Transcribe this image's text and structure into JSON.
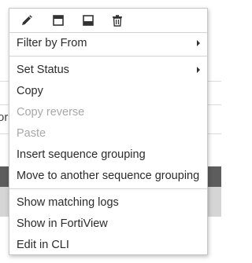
{
  "background": {
    "fragment_text": "or"
  },
  "toolbar": {
    "icons": [
      "pencil-icon",
      "dock-top-icon",
      "dock-bottom-icon",
      "trash-icon"
    ]
  },
  "menu": {
    "filter_by_from": "Filter by From",
    "set_status": "Set Status",
    "copy": "Copy",
    "copy_reverse": "Copy reverse",
    "paste": "Paste",
    "insert_sequence_grouping": "Insert sequence grouping",
    "move_to_sequence_grouping": "Move to another sequence grouping",
    "show_matching_logs": "Show matching logs",
    "show_in_fortiview": "Show in FortiView",
    "edit_in_cli": "Edit in CLI"
  },
  "colors": {
    "text": "#2b2b2b",
    "disabled_text": "#a8a8a8",
    "separator": "#d4d4d4"
  }
}
